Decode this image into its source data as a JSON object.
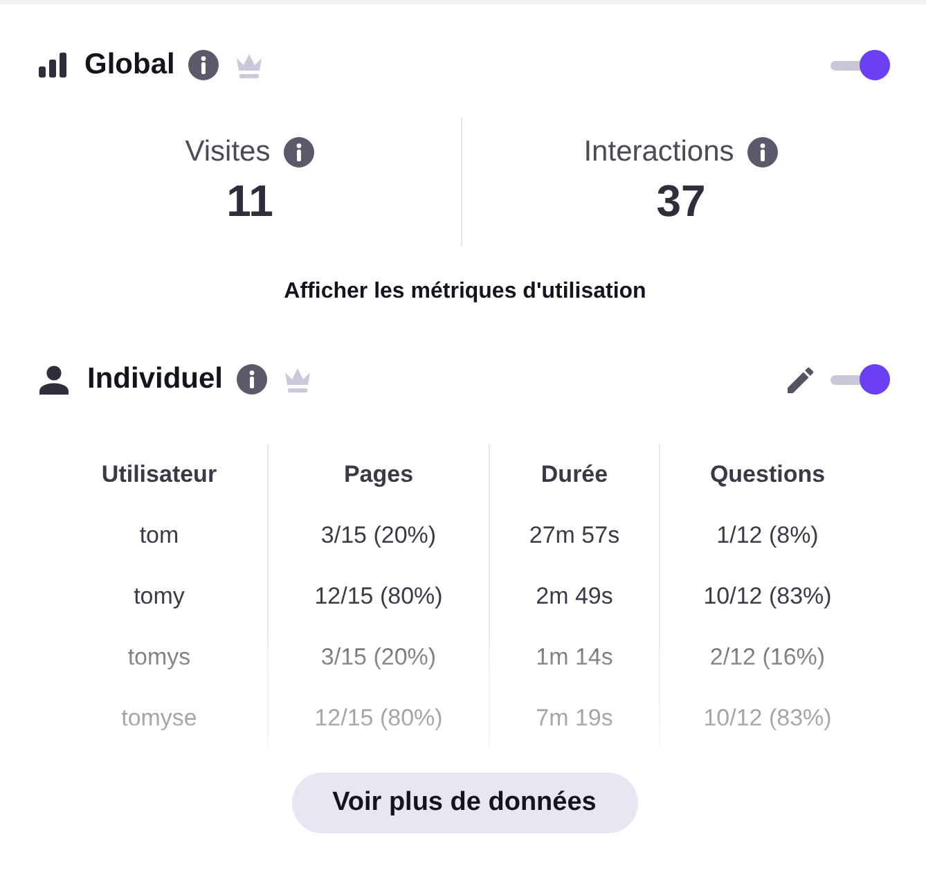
{
  "global": {
    "title": "Global",
    "toggle": {
      "on": true
    },
    "stats": [
      {
        "label": "Visites",
        "value": "11"
      },
      {
        "label": "Interactions",
        "value": "37"
      }
    ],
    "link": "Afficher les métriques d'utilisation"
  },
  "individual": {
    "title": "Individuel",
    "toggle": {
      "on": true
    },
    "table": {
      "columns": [
        "Utilisateur",
        "Pages",
        "Durée",
        "Questions"
      ],
      "rows": [
        [
          "tom",
          "3/15 (20%)",
          "27m 57s",
          "1/12 (8%)"
        ],
        [
          "tomy",
          "12/15 (80%)",
          "2m 49s",
          "10/12 (83%)"
        ],
        [
          "tomys",
          "3/15 (20%)",
          "1m 14s",
          "2/12 (16%)"
        ],
        [
          "tomyse",
          "12/15 (80%)",
          "7m 19s",
          "10/12 (83%)"
        ]
      ]
    }
  },
  "more_button": {
    "label": "Voir plus de données"
  }
}
